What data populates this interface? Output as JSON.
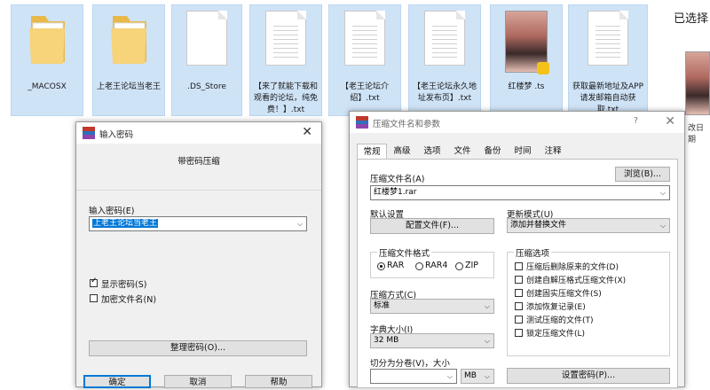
{
  "explorer": {
    "files": [
      {
        "name": "_MACOSX",
        "icon": "folder-icon"
      },
      {
        "name": "上老王论坛当老王",
        "icon": "folder-icon"
      },
      {
        "name": ".DS_Store",
        "icon": "file-icon"
      },
      {
        "name": "【来了就能下载和观看的论坛，纯免费！】.txt",
        "icon": "text-file-icon"
      },
      {
        "name": "【老王论坛介绍】.txt",
        "icon": "text-file-icon"
      },
      {
        "name": "【老王论坛永久地址发布页】.txt",
        "icon": "text-file-icon"
      },
      {
        "name": "红楼梦 .ts",
        "icon": "video-thumbnail"
      },
      {
        "name": "获取最新地址及APP请发邮箱自动获取.txt",
        "icon": "text-file-icon"
      }
    ],
    "side_text": "已选择",
    "side_date": "改日期"
  },
  "password_dialog": {
    "title": "输入密码",
    "heading": "带密码压缩",
    "field_label": "输入密码(E)",
    "field_value": "上老王论坛当老王",
    "show_password_label": "显示密码(S)",
    "show_password_checked": true,
    "encrypt_names_label": "加密文件名(N)",
    "encrypt_names_checked": false,
    "organize_button": "整理密码(O)...",
    "ok_button": "确定",
    "cancel_button": "取消",
    "help_button": "帮助"
  },
  "archive_dialog": {
    "title": "压缩文件名和参数",
    "help_glyph": "?",
    "close_glyph": "✕",
    "tabs": [
      "常规",
      "高级",
      "选项",
      "文件",
      "备份",
      "时间",
      "注释"
    ],
    "active_tab": "常规",
    "archive_name_label": "压缩文件名(A)",
    "browse_button": "浏览(B)...",
    "archive_name_value": "红楼梦1.rar",
    "default_settings_label": "默认设置",
    "profiles_button": "配置文件(F)...",
    "update_mode_label": "更新模式(U)",
    "update_mode_value": "添加并替换文件",
    "format_group_label": "压缩文件格式",
    "formats": [
      "RAR",
      "RAR4",
      "ZIP"
    ],
    "selected_format": "RAR",
    "options_group_label": "压缩选项",
    "options": [
      {
        "label": "压缩后删除原来的文件(D)",
        "checked": false
      },
      {
        "label": "创建自解压格式压缩文件(X)",
        "checked": false
      },
      {
        "label": "创建固实压缩文件(S)",
        "checked": false
      },
      {
        "label": "添加恢复记录(E)",
        "checked": false
      },
      {
        "label": "测试压缩的文件(T)",
        "checked": false
      },
      {
        "label": "锁定压缩文件(L)",
        "checked": false
      }
    ],
    "method_label": "压缩方式(C)",
    "method_value": "标准",
    "dict_label": "字典大小(I)",
    "dict_value": "32 MB",
    "split_label": "切分为分卷(V)，大小",
    "split_value": "",
    "split_unit": "MB",
    "set_password_button": "设置密码(P)..."
  },
  "colors": {
    "selection_blue": "#0078d7",
    "explorer_item_bg": "#cfe3f7",
    "dialog_bg": "#f0f0f0"
  }
}
